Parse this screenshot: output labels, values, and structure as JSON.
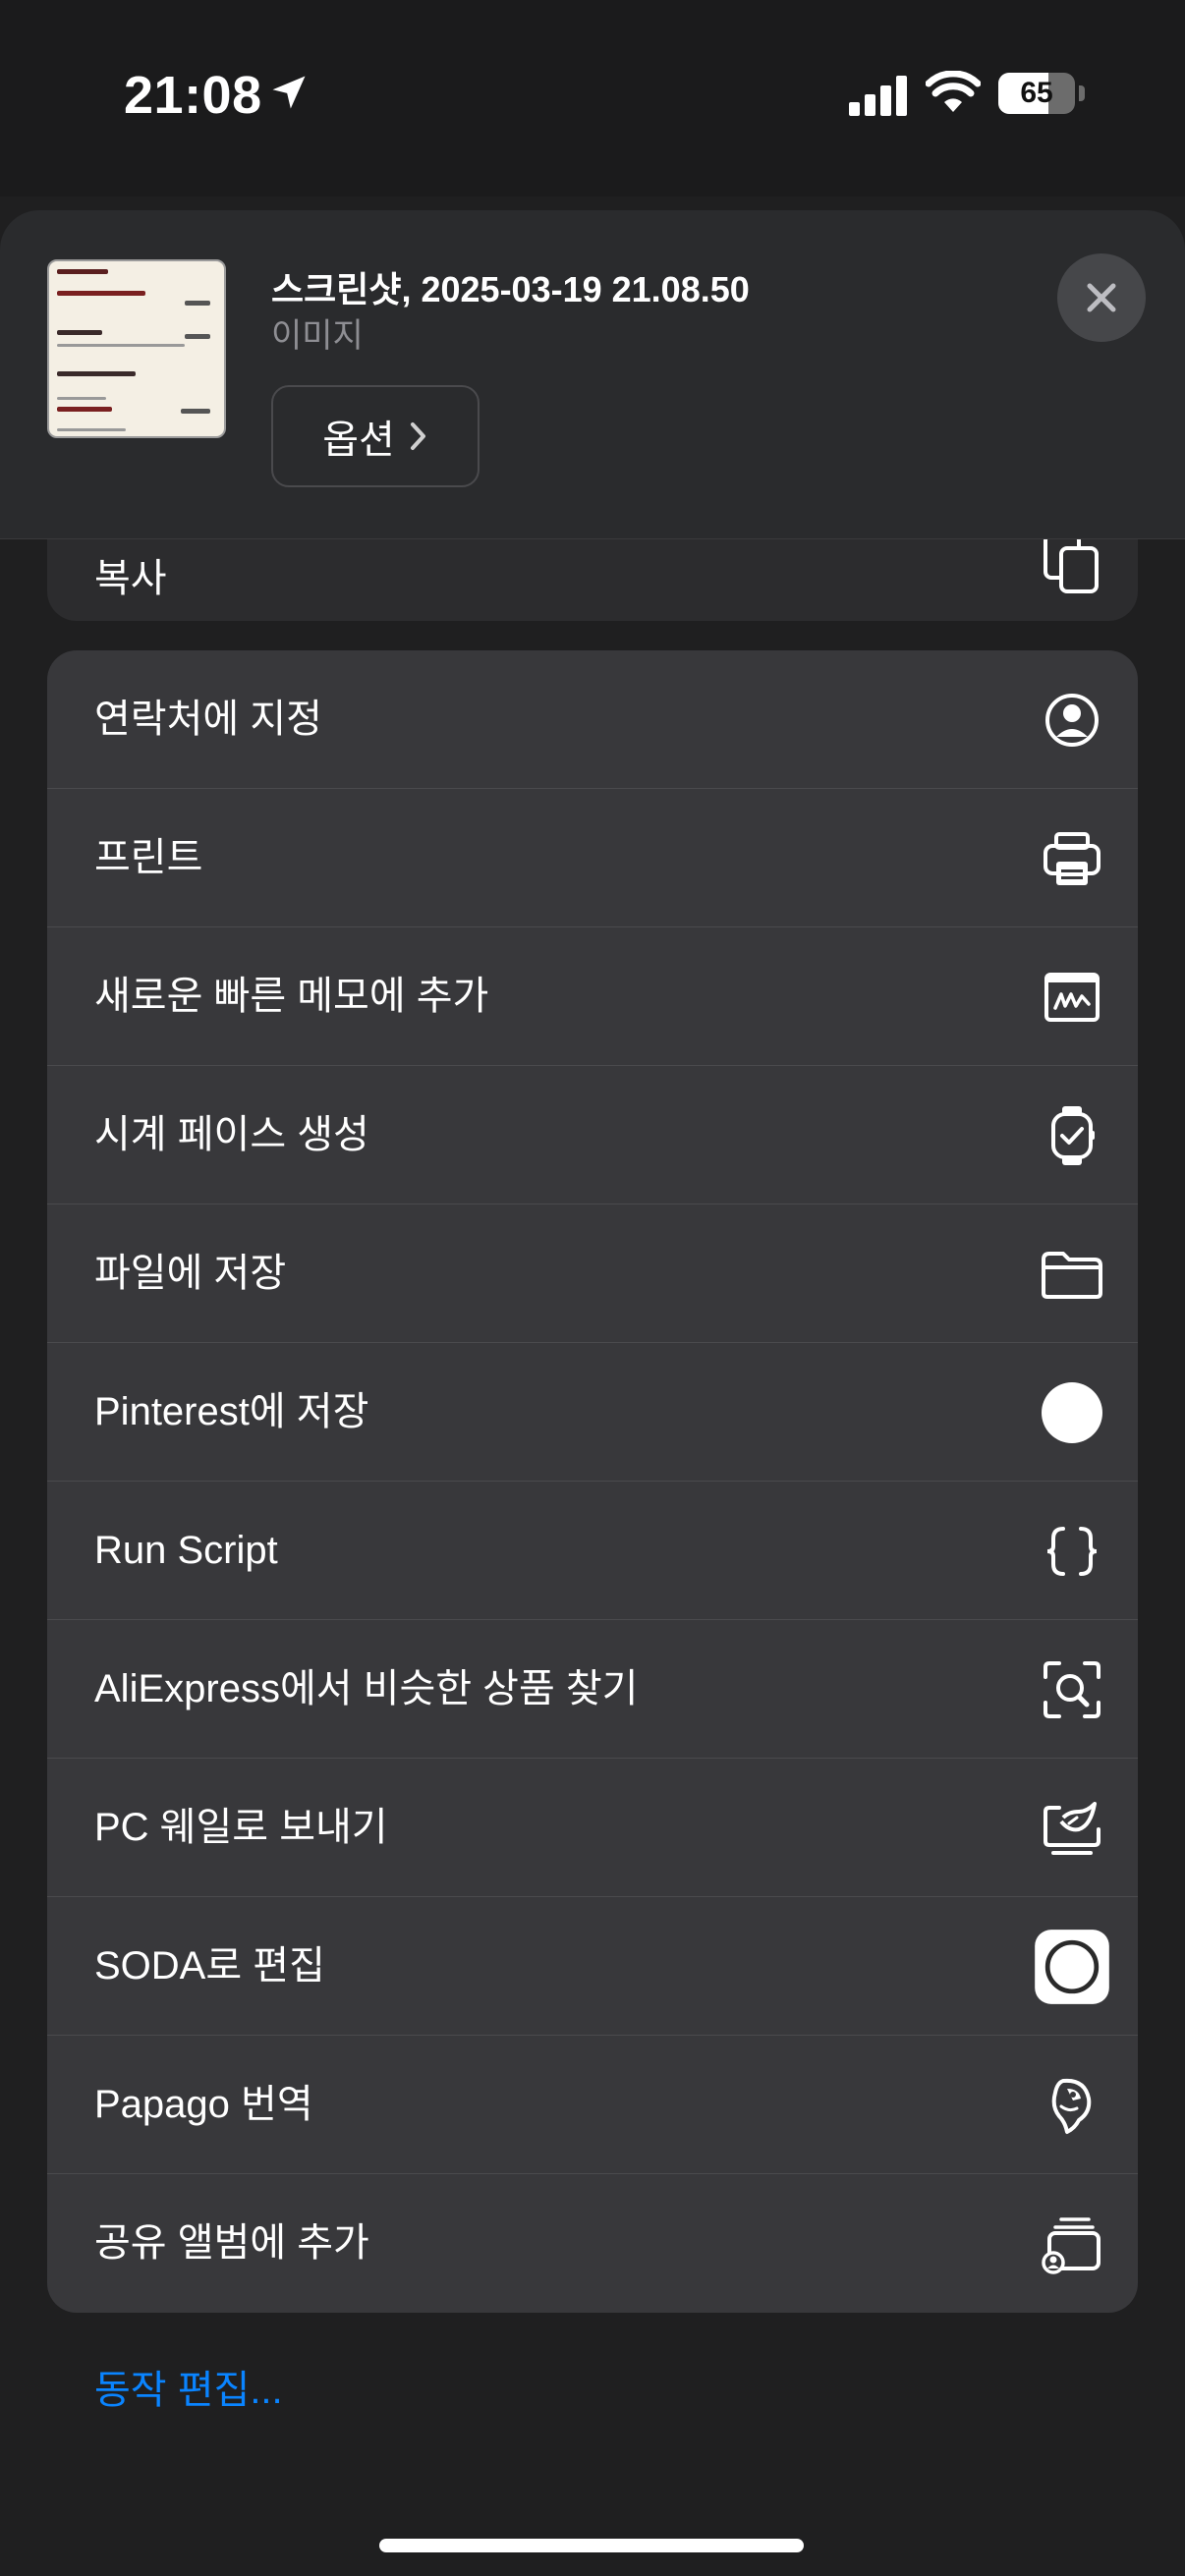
{
  "status_bar": {
    "time": "21:08",
    "battery": "65",
    "battery_level": 0.65,
    "icons": [
      "location-arrow-icon",
      "cellular-signal-icon",
      "wifi-icon",
      "battery-icon"
    ]
  },
  "header": {
    "title": "스크린샷, 2025-03-19 21.08.50",
    "subtitle": "이미지",
    "options_label": "옵션",
    "close_icon": "close-icon"
  },
  "copy": {
    "label": "복사",
    "icon": "copy-icon"
  },
  "actions": [
    {
      "label": "연락처에 지정",
      "icon": "person-circle-icon"
    },
    {
      "label": "프린트",
      "icon": "printer-icon"
    },
    {
      "label": "새로운 빠른 메모에 추가",
      "icon": "quick-note-icon"
    },
    {
      "label": "시계 페이스 생성",
      "icon": "watch-icon"
    },
    {
      "label": "파일에 저장",
      "icon": "folder-icon"
    },
    {
      "label": "Pinterest에 저장",
      "icon": "pinterest-icon"
    },
    {
      "label": "Run Script",
      "icon": "braces-icon"
    },
    {
      "label": "AliExpress에서 비슷한 상품 찾기",
      "icon": "visual-search-icon"
    },
    {
      "label": "PC 웨일로 보내기",
      "icon": "whale-send-icon"
    },
    {
      "label": "SODA로 편집",
      "icon": "soda-icon"
    },
    {
      "label": "Papago 번역",
      "icon": "papago-parrot-icon"
    },
    {
      "label": "공유 앨범에 추가",
      "icon": "shared-album-icon"
    }
  ],
  "footer": {
    "edit_actions_label": "동작 편집..."
  },
  "colors": {
    "background": "#1f1f20",
    "card": "#38383b",
    "accent": "#0a84ff"
  }
}
